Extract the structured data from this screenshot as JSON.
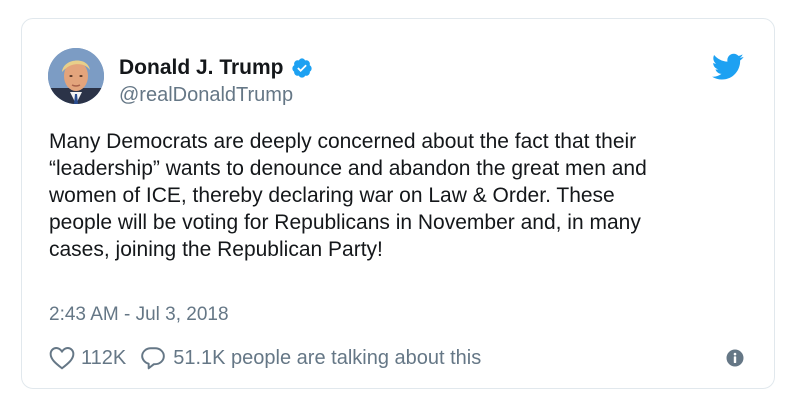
{
  "author": {
    "display_name": "Donald J. Trump",
    "handle": "@realDonaldTrump",
    "verified": true,
    "avatar_icon": "profile-photo"
  },
  "tweet": {
    "text_lines": [
      "Many Democrats are deeply concerned about the fact that their",
      "“leadership” wants to denounce and abandon the great men and",
      "women of ICE, thereby declaring war on Law & Order. These",
      "people will be voting for Republicans in November and, in many",
      "cases, joining the Republican Party!"
    ],
    "timestamp": "2:43 AM - Jul 3, 2018"
  },
  "actions": {
    "like_count": "112K",
    "talking_text": "51.1K people are talking about this"
  },
  "icons": {
    "brand": "twitter-bird-icon",
    "verified": "verified-badge-icon",
    "like": "heart-icon",
    "reply": "speech-bubble-icon",
    "info": "info-icon"
  },
  "colors": {
    "brand_blue": "#1da1f2",
    "text_primary": "#14171a",
    "text_secondary": "#657786",
    "border": "#e1e8ed"
  }
}
